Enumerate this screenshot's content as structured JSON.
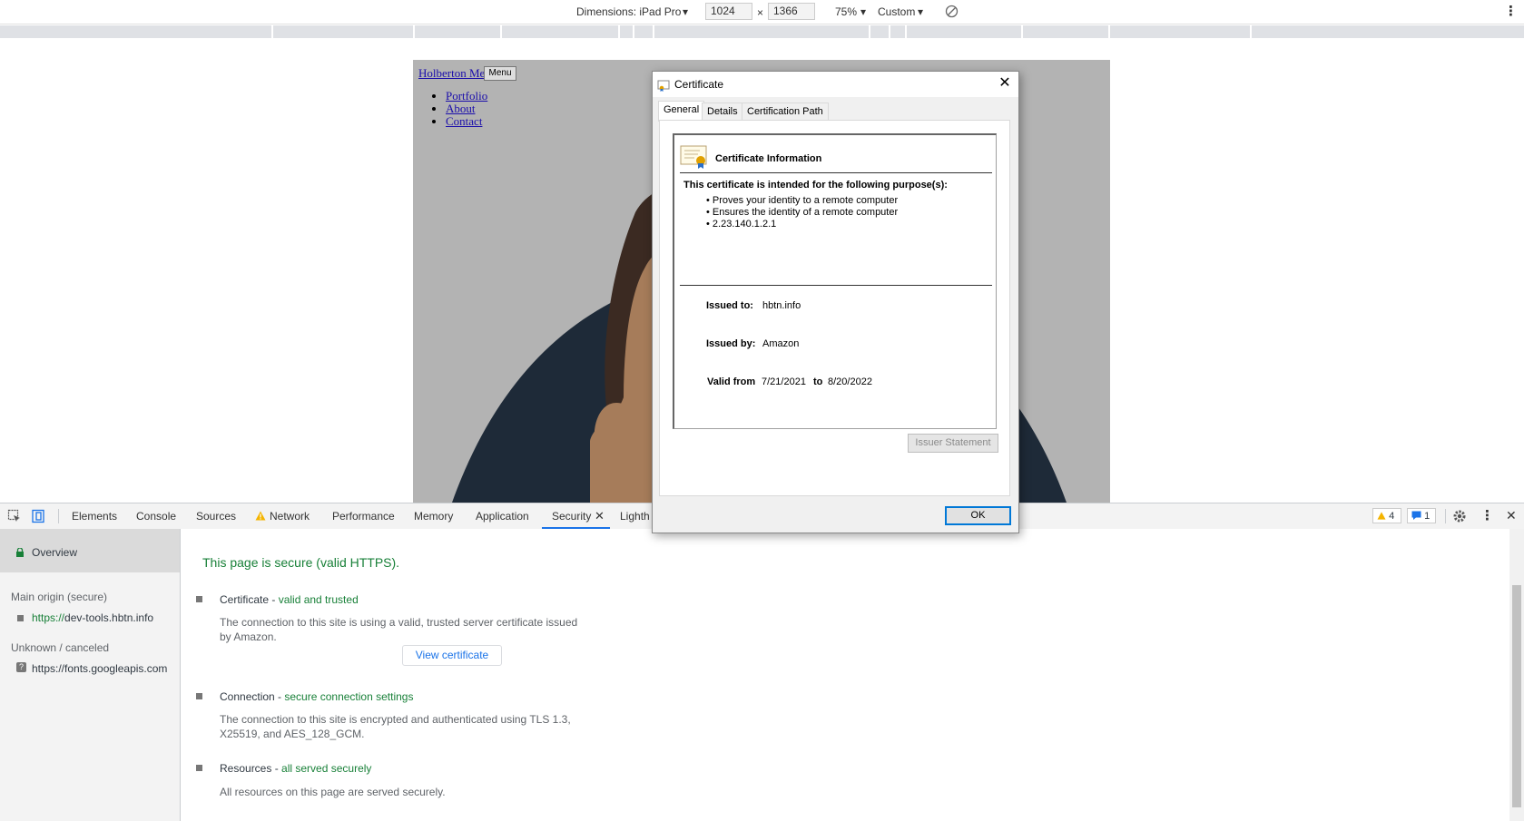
{
  "device_toolbar": {
    "dimensions_label": "Dimensions: iPad Pro",
    "width": "1024",
    "height": "1366",
    "times": "×",
    "zoom": "75%",
    "throttle": "Custom"
  },
  "viewport": {
    "brand": "Holberton Me",
    "menu_button": "Menu",
    "nav": [
      "Portfolio",
      "About",
      "Contact"
    ]
  },
  "devtools": {
    "tabs": [
      "Elements",
      "Console",
      "Sources",
      "Network",
      "Performance",
      "Memory",
      "Application",
      "Security",
      "Lighth"
    ],
    "active_tab": "Security",
    "warnings_count": "4",
    "messages_count": "1",
    "sidebar": {
      "overview": "Overview",
      "main_origin_heading": "Main origin (secure)",
      "main_origin_scheme": "https://",
      "main_origin_host": "dev-tools.hbtn.info",
      "unknown_heading": "Unknown / canceled",
      "unknown_origin": "https://fonts.googleapis.com"
    },
    "security": {
      "headline": "This page is secure (valid HTTPS).",
      "certificate_title": "Certificate - ",
      "certificate_status": "valid and trusted",
      "certificate_desc": "The connection to this site is using a valid, trusted server certificate issued by Amazon.",
      "view_certificate": "View certificate",
      "connection_title": "Connection - ",
      "connection_status": "secure connection settings",
      "connection_desc": "The connection to this site is encrypted and authenticated using TLS 1.3, X25519, and AES_128_GCM.",
      "resources_title": "Resources - ",
      "resources_status": "all served securely",
      "resources_desc": "All resources on this page are served securely."
    }
  },
  "certificate_dialog": {
    "title": "Certificate",
    "close": "✕",
    "tabs": [
      "General",
      "Details",
      "Certification Path"
    ],
    "info_heading": "Certificate Information",
    "purpose_heading": "This certificate is intended for the following purpose(s):",
    "purposes": [
      "Proves your identity to a remote computer",
      "Ensures the identity of a remote computer",
      "2.23.140.1.2.1"
    ],
    "issued_to_label": "Issued to:",
    "issued_to": "hbtn.info",
    "issued_by_label": "Issued by:",
    "issued_by": "Amazon",
    "valid_from_label": "Valid from",
    "valid_from": "7/21/2021",
    "to_label": "to",
    "valid_to": "8/20/2022",
    "issuer_statement": "Issuer Statement",
    "ok": "OK"
  },
  "colors": {
    "accent": "#1a73e8",
    "secure_green": "#188038",
    "warning": "#f4b400",
    "portrait_dark": "#1e2a38",
    "portrait_skin": "#a67c5a",
    "portrait_hair": "#3b2a22"
  }
}
